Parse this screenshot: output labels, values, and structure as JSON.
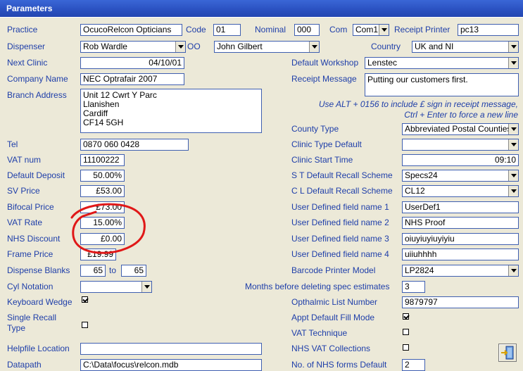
{
  "window": {
    "title": "Parameters"
  },
  "left": {
    "practice": {
      "label": "Practice",
      "value": "OcucoRelcon Opticians"
    },
    "code": {
      "label": "Code",
      "value": "01"
    },
    "nominal": {
      "label": "Nominal",
      "value": "000"
    },
    "com": {
      "label": "Com",
      "value": "Com1"
    },
    "receipt_printer": {
      "label": "Receipt Printer",
      "value": "pc13"
    },
    "dispenser": {
      "label": "Dispenser",
      "value": "Rob Wardle"
    },
    "oo": {
      "label": "OO",
      "value": "John Gilbert"
    },
    "country": {
      "label": "Country",
      "value": "UK and NI"
    },
    "next_clinic": {
      "label": "Next Clinic",
      "value": "04/10/01"
    },
    "company_name": {
      "label": "Company Name",
      "value": "NEC Optrafair 2007"
    },
    "branch_address": {
      "label": "Branch Address",
      "value": "Unit 12 Cwrt Y Parc\nLlanishen\nCardiff\nCF14 5GH"
    },
    "tel": {
      "label": "Tel",
      "value": "0870 060 0428"
    },
    "vat_num": {
      "label": "VAT num",
      "value": "11100222"
    },
    "default_deposit": {
      "label": "Default Deposit",
      "value": "50.00%"
    },
    "sv_price": {
      "label": "SV Price",
      "value": "£53.00"
    },
    "bifocal_price": {
      "label": "Bifocal  Price",
      "value": "£73.00"
    },
    "vat_rate": {
      "label": "VAT Rate",
      "value": "15.00%"
    },
    "nhs_discount": {
      "label": "NHS Discount",
      "value": "£0.00"
    },
    "frame_price": {
      "label": "Frame Price",
      "value": "£19.99"
    },
    "dispense_blanks": {
      "label": "Dispense Blanks",
      "from": "65",
      "to_label": "to",
      "to": "65"
    },
    "cyl_notation": {
      "label": "Cyl Notation",
      "value": ""
    },
    "keyboard_wedge": {
      "label": "Keyboard Wedge",
      "checked": true
    },
    "single_recall_type": {
      "label": "Single Recall Type",
      "checked": false
    },
    "helpfile_location": {
      "label": "Helpfile Location",
      "value": ""
    },
    "datapath": {
      "label": "Datapath",
      "value": "C:\\Data\\focus\\relcon.mdb"
    }
  },
  "right": {
    "default_workshop": {
      "label": "Default Workshop",
      "value": "Lenstec"
    },
    "receipt_message": {
      "label": "Receipt Message",
      "value": "Putting our customers first."
    },
    "receipt_hint": "Use ALT + 0156 to include £ sign in receipt message, Ctrl + Enter to force a new line",
    "county_type": {
      "label": "County Type",
      "value": "Abbreviated Postal Counties"
    },
    "clinic_type_default": {
      "label": "Clinic Type Default",
      "value": ""
    },
    "clinic_start_time": {
      "label": "Clinic Start Time",
      "value": "09:10"
    },
    "st_recall": {
      "label": "S T Default Recall Scheme",
      "value": "Specs24"
    },
    "cl_recall": {
      "label": "C L Default Recall Scheme",
      "value": "CL12"
    },
    "udf1": {
      "label": "User Defined field name 1",
      "value": "UserDef1"
    },
    "udf2": {
      "label": "User Defined field name 2",
      "value": "NHS Proof"
    },
    "udf3": {
      "label": "User Defined field name 3",
      "value": "oiuyiuyiuyiyiu"
    },
    "udf4": {
      "label": "User Defined field name 4",
      "value": "uiiuhhhh"
    },
    "barcode_printer": {
      "label": "Barcode Printer Model",
      "value": "LP2824"
    },
    "months_before_deleting": {
      "label": "Months before deleting spec estimates",
      "value": "3"
    },
    "opthalmic_list_number": {
      "label": "Opthalmic List Number",
      "value": "9879797"
    },
    "appt_default_fill": {
      "label": "Appt Default Fill Mode",
      "checked": true
    },
    "vat_technique": {
      "label": "VAT Technique",
      "checked": false
    },
    "nhs_vat_collections": {
      "label": "NHS VAT Collections",
      "checked": false
    },
    "nhs_forms_default": {
      "label": "No. of NHS forms Default",
      "value": "2"
    }
  },
  "colors": {
    "title_bar": "#2a50c0",
    "label_text": "#1e3ea9",
    "annotation": "#e01818"
  },
  "icons": {
    "exit": "exit-door-icon",
    "annotation": "red-circle-annotation"
  }
}
